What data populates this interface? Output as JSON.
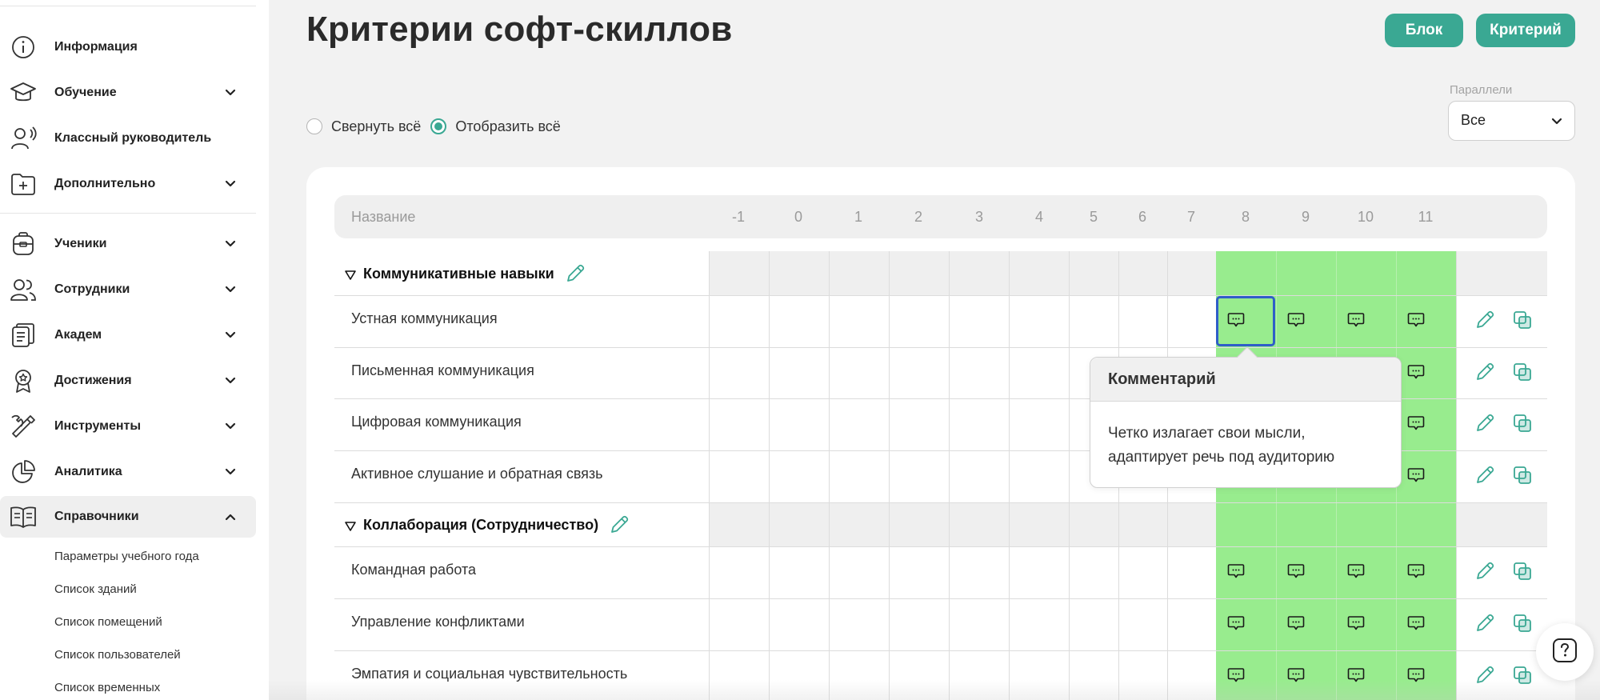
{
  "sidebar": {
    "items": [
      {
        "label": "Информация",
        "icon": "info-icon",
        "expandable": false
      },
      {
        "label": "Обучение",
        "icon": "graduation-cap-icon",
        "expandable": true
      },
      {
        "label": "Классный руководитель",
        "icon": "teacher-icon",
        "expandable": false
      },
      {
        "label": "Дополнительно",
        "icon": "folder-plus-icon",
        "expandable": true
      },
      {
        "label": "Ученики",
        "icon": "backpack-icon",
        "expandable": true
      },
      {
        "label": "Сотрудники",
        "icon": "users-icon",
        "expandable": true
      },
      {
        "label": "Академ",
        "icon": "document-icon",
        "expandable": true
      },
      {
        "label": "Достижения",
        "icon": "award-icon",
        "expandable": true
      },
      {
        "label": "Инструменты",
        "icon": "tools-icon",
        "expandable": true
      },
      {
        "label": "Аналитика",
        "icon": "pie-chart-icon",
        "expandable": true
      },
      {
        "label": "Справочники",
        "icon": "book-icon",
        "expandable": true,
        "active": true
      }
    ],
    "subitems": [
      "Параметры учебного года",
      "Список зданий",
      "Список помещений",
      "Список пользователей",
      "Список временных"
    ]
  },
  "header": {
    "title": "Критерии софт-скиллов",
    "btn_block": "Блок",
    "btn_criterion": "Критерий"
  },
  "view_toggle": {
    "collapse_label": "Свернуть всё",
    "expand_label": "Отобразить всё",
    "selected": "expand"
  },
  "parallel_filter": {
    "label": "Параллели",
    "value": "Все"
  },
  "table": {
    "name_header": "Название",
    "grade_headers": [
      "-1",
      "0",
      "1",
      "2",
      "3",
      "4",
      "5",
      "6",
      "7",
      "8",
      "9",
      "10",
      "11"
    ],
    "active_grades": [
      "8",
      "9",
      "10",
      "11"
    ],
    "groups": [
      {
        "title": "Коммуникативные навыки",
        "rows": [
          "Устная коммуникация",
          "Письменная коммуникация",
          "Цифровая коммуникация",
          "Активное слушание и обратная связь"
        ]
      },
      {
        "title": "Коллаборация (Сотрудничество)",
        "rows": [
          "Командная работа",
          "Управление конфликтами",
          "Эмпатия и социальная чувствительность"
        ]
      }
    ]
  },
  "tooltip": {
    "title": "Комментарий",
    "line1": "Четко излагает свои мысли,",
    "line2": "адаптирует речь под аудиторию"
  },
  "colors": {
    "accent": "#3aa893",
    "active_grade_bg": "#98ec8e",
    "focus_border": "#2f5ec8",
    "group_row_bg": "#efefef"
  }
}
